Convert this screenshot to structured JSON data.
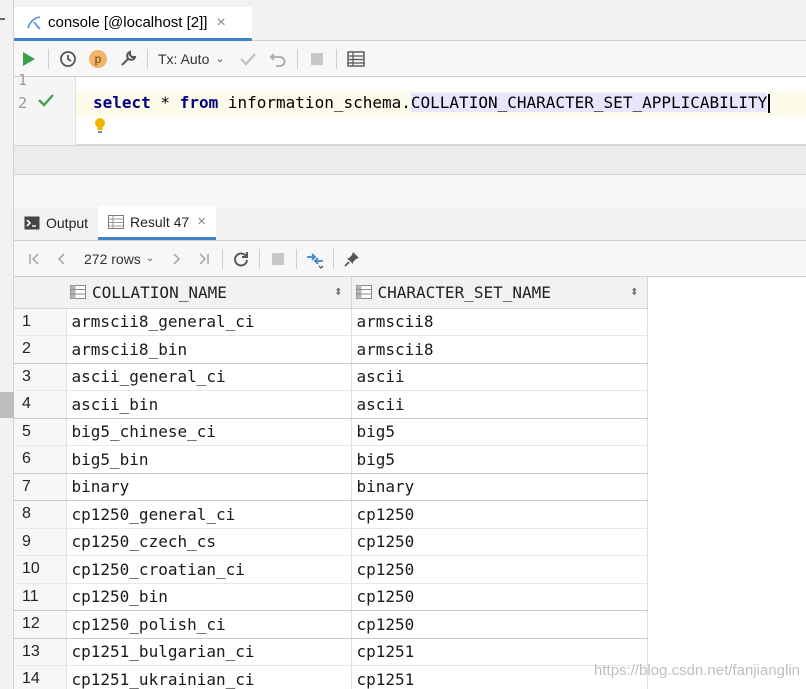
{
  "editor_tab": {
    "label": "console [@localhost [2]]",
    "close": "×"
  },
  "toolbar": {
    "tx_label": "Tx: Auto"
  },
  "editor": {
    "line1": "1",
    "line2": "2",
    "kw_select": "select",
    "star": " * ",
    "kw_from": "from",
    "schema": " information_schema.",
    "table": "COLLATION_CHARACTER_SET_APPLICABILITY"
  },
  "results_tabs": [
    {
      "label": "Output"
    },
    {
      "label": "Result 47",
      "close": "×"
    }
  ],
  "results_toolbar": {
    "rows_label": "272 rows"
  },
  "grid": {
    "columns": [
      "COLLATION_NAME",
      "CHARACTER_SET_NAME"
    ],
    "rows": [
      {
        "n": "1",
        "collation": "armscii8_general_ci",
        "charset": "armscii8"
      },
      {
        "n": "2",
        "collation": "armscii8_bin",
        "charset": "armscii8"
      },
      {
        "n": "3",
        "collation": "ascii_general_ci",
        "charset": "ascii"
      },
      {
        "n": "4",
        "collation": "ascii_bin",
        "charset": "ascii"
      },
      {
        "n": "5",
        "collation": "big5_chinese_ci",
        "charset": "big5"
      },
      {
        "n": "6",
        "collation": "big5_bin",
        "charset": "big5"
      },
      {
        "n": "7",
        "collation": "binary",
        "charset": "binary"
      },
      {
        "n": "8",
        "collation": "cp1250_general_ci",
        "charset": "cp1250"
      },
      {
        "n": "9",
        "collation": "cp1250_czech_cs",
        "charset": "cp1250"
      },
      {
        "n": "10",
        "collation": "cp1250_croatian_ci",
        "charset": "cp1250"
      },
      {
        "n": "11",
        "collation": "cp1250_bin",
        "charset": "cp1250"
      },
      {
        "n": "12",
        "collation": "cp1250_polish_ci",
        "charset": "cp1250"
      },
      {
        "n": "13",
        "collation": "cp1251_bulgarian_ci",
        "charset": "cp1251"
      },
      {
        "n": "14",
        "collation": "cp1251_ukrainian_ci",
        "charset": "cp1251"
      }
    ]
  },
  "watermark": "https://blog.csdn.net/fanjianglin",
  "colors": {
    "accent": "#4083c9",
    "keyword": "#000080",
    "selection": "#e8e6ff"
  }
}
